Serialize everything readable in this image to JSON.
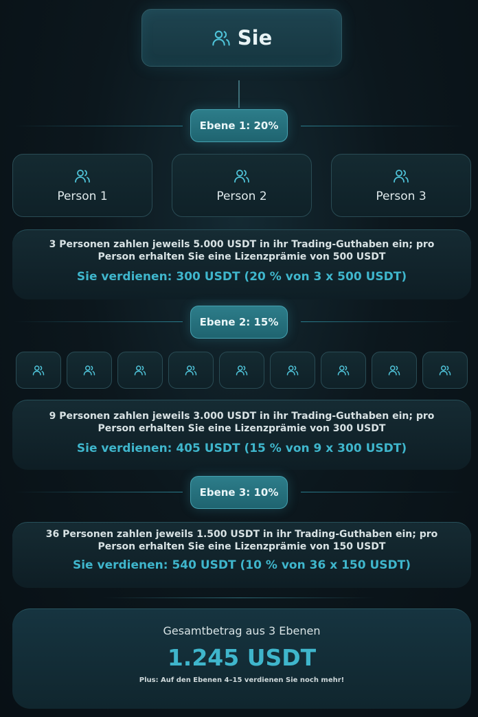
{
  "root": {
    "label": "Sie",
    "icon": "users-icon"
  },
  "levels": [
    {
      "badge": "Ebene 1: 20%",
      "persons": [
        "Person 1",
        "Person 2",
        "Person 3"
      ],
      "description": "3 Personen zahlen jeweils 5.000 USDT in ihr Trading-Guthaben ein; pro Person erhalten Sie eine Lizenzprämie von 500 USDT",
      "earnings": "Sie verdienen: 300 USDT (20 % von 3 x 500 USDT)"
    },
    {
      "badge": "Ebene 2: 15%",
      "person_icon_count": 9,
      "description": "9 Personen zahlen jeweils 3.000 USDT in ihr Trading-Guthaben ein; pro Person erhalten Sie eine Lizenzprämie von 300 USDT",
      "earnings": "Sie verdienen: 405 USDT (15 % von 9 x 300 USDT)"
    },
    {
      "badge": "Ebene 3: 10%",
      "description": "36 Personen zahlen jeweils 1.500 USDT in ihr Trading-Guthaben ein; pro Person erhalten Sie eine Lizenzprämie von 150 USDT",
      "earnings": "Sie verdienen: 540 USDT (10 % von 36 x 150 USDT)"
    }
  ],
  "total": {
    "title": "Gesamtbetrag aus 3 Ebenen",
    "amount": "1.245 USDT",
    "note": "Plus: Auf den Ebenen 4–15 verdienen Sie noch mehr!"
  },
  "colors": {
    "accent": "#3fb6cc",
    "badge": "#2d7d8a",
    "background": "#0c171d"
  }
}
